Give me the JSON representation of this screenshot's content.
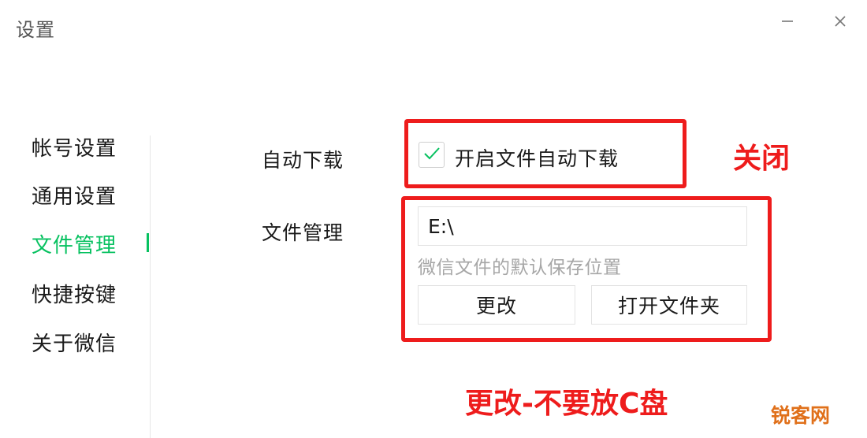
{
  "window": {
    "title": "设置"
  },
  "sidebar": {
    "items": [
      {
        "label": "帐号设置",
        "active": false
      },
      {
        "label": "通用设置",
        "active": false
      },
      {
        "label": "文件管理",
        "active": true
      },
      {
        "label": "快捷按键",
        "active": false
      },
      {
        "label": "关于微信",
        "active": false
      }
    ]
  },
  "auto_download": {
    "label": "自动下载",
    "checkbox_label": "开启文件自动下载",
    "checked": true
  },
  "file_management": {
    "label": "文件管理",
    "path_value": "E:\\",
    "hint": "微信文件的默认保存位置",
    "change_button": "更改",
    "open_folder_button": "打开文件夹"
  },
  "annotations": {
    "close_note": "关闭",
    "change_note": "更改-不要放C盘"
  },
  "watermark": {
    "text": "锐客网"
  },
  "colors": {
    "accent": "#07c160",
    "annotation": "#ee1c1c",
    "watermark": "#e0701a"
  },
  "icons": {
    "minimize": "minimize-icon",
    "close": "close-icon",
    "check": "checkmark-icon"
  }
}
